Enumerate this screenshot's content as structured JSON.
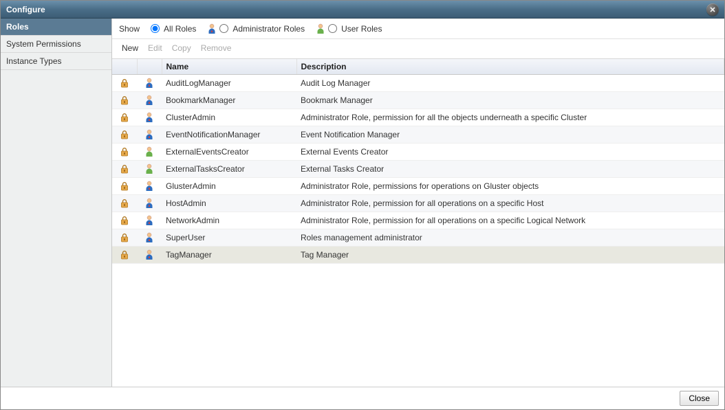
{
  "window": {
    "title": "Configure"
  },
  "sidebar": {
    "items": [
      {
        "label": "Roles",
        "selected": true
      },
      {
        "label": "System Permissions",
        "selected": false
      },
      {
        "label": "Instance Types",
        "selected": false
      }
    ]
  },
  "filter": {
    "show_label": "Show",
    "options": [
      {
        "label": "All Roles",
        "icon": null,
        "checked": true
      },
      {
        "label": "Administrator Roles",
        "icon": "admin",
        "checked": false
      },
      {
        "label": "User Roles",
        "icon": "user",
        "checked": false
      }
    ]
  },
  "actions": {
    "new_label": "New",
    "edit_label": "Edit",
    "copy_label": "Copy",
    "remove_label": "Remove",
    "new_enabled": true,
    "edit_enabled": false,
    "copy_enabled": false,
    "remove_enabled": false
  },
  "table": {
    "columns": {
      "name": "Name",
      "description": "Description"
    },
    "rows": [
      {
        "locked": true,
        "type": "admin",
        "name": "AuditLogManager",
        "description": "Audit Log Manager",
        "selected": false
      },
      {
        "locked": true,
        "type": "admin",
        "name": "BookmarkManager",
        "description": "Bookmark Manager",
        "selected": false
      },
      {
        "locked": true,
        "type": "admin",
        "name": "ClusterAdmin",
        "description": "Administrator Role, permission for all the objects underneath a specific Cluster",
        "selected": false
      },
      {
        "locked": true,
        "type": "admin",
        "name": "EventNotificationManager",
        "description": "Event Notification Manager",
        "selected": false
      },
      {
        "locked": true,
        "type": "user",
        "name": "ExternalEventsCreator",
        "description": "External Events Creator",
        "selected": false
      },
      {
        "locked": true,
        "type": "user",
        "name": "ExternalTasksCreator",
        "description": "External Tasks Creator",
        "selected": false
      },
      {
        "locked": true,
        "type": "admin",
        "name": "GlusterAdmin",
        "description": "Administrator Role, permissions for operations on Gluster objects",
        "selected": false
      },
      {
        "locked": true,
        "type": "admin",
        "name": "HostAdmin",
        "description": "Administrator Role, permission for all operations on a specific Host",
        "selected": false
      },
      {
        "locked": true,
        "type": "admin",
        "name": "NetworkAdmin",
        "description": "Administrator Role, permission for all operations on a specific Logical Network",
        "selected": false
      },
      {
        "locked": true,
        "type": "admin",
        "name": "SuperUser",
        "description": "Roles management administrator",
        "selected": false
      },
      {
        "locked": true,
        "type": "admin",
        "name": "TagManager",
        "description": "Tag Manager",
        "selected": true
      }
    ]
  },
  "footer": {
    "close_label": "Close"
  }
}
